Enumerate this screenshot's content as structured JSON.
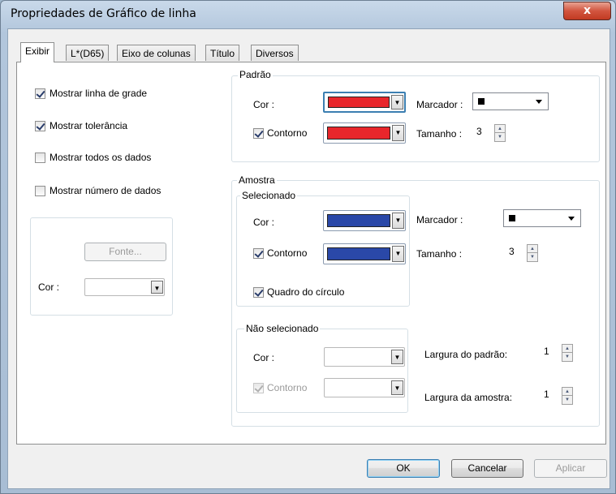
{
  "window": {
    "title": "Propriedades de Gráfico de linha",
    "close_label": "x"
  },
  "tabs": [
    {
      "label": "Exibir",
      "active": true
    },
    {
      "label": "L*(D65)",
      "active": false
    },
    {
      "label": "Eixo de colunas",
      "active": false
    },
    {
      "label": "Título",
      "active": false
    },
    {
      "label": "Diversos",
      "active": false
    }
  ],
  "left_options": [
    {
      "label": "Mostrar linha de grade",
      "checked": true
    },
    {
      "label": "Mostrar tolerância",
      "checked": true
    },
    {
      "label": "Mostrar todos os dados",
      "checked": false
    },
    {
      "label": "Mostrar número de dados",
      "checked": false
    }
  ],
  "font_group": {
    "font_button": "Fonte...",
    "color_label": "Cor :"
  },
  "padrao": {
    "legend": "Padrão",
    "color_label": "Cor :",
    "color": "#e8262b",
    "outline_label": "Contorno",
    "outline_checked": true,
    "outline_color": "#e8262b",
    "marker_label": "Marcador :",
    "size_label": "Tamanho :",
    "size_value": "3"
  },
  "amostra": {
    "legend": "Amostra",
    "selected": {
      "legend": "Selecionado",
      "color_label": "Cor :",
      "color": "#2a48a8",
      "outline_label": "Contorno",
      "outline_checked": true,
      "outline_color": "#2a48a8",
      "circle_frame_label": "Quadro do círculo",
      "circle_frame_checked": true,
      "marker_label": "Marcador :",
      "size_label": "Tamanho :",
      "size_value": "3"
    },
    "unselected": {
      "legend": "Não selecionado",
      "color_label": "Cor :",
      "outline_label": "Contorno",
      "outline_checked": true,
      "pattern_width_label": "Largura do padrão:",
      "pattern_width_value": "1",
      "sample_width_label": "Largura da amostra:",
      "sample_width_value": "1"
    }
  },
  "footer": {
    "ok": "OK",
    "cancel": "Cancelar",
    "apply": "Aplicar"
  },
  "colors": {
    "accent_focus": "#3c7fb1",
    "window_frame": "#b2c6dc"
  }
}
